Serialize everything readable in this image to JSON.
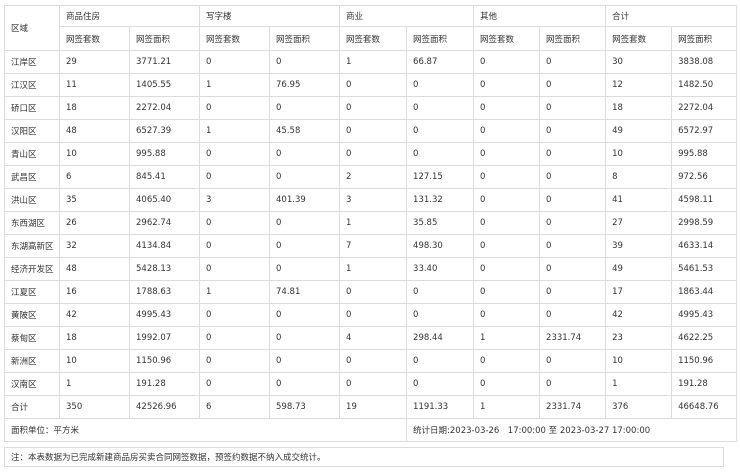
{
  "headers": {
    "district": "区域",
    "groups": [
      "商品住房",
      "写字楼",
      "商业",
      "其他",
      "合计"
    ],
    "sub_count": "网签套数",
    "sub_area": "网签面积"
  },
  "rows": [
    {
      "name": "江岸区",
      "v": [
        "29",
        "3771.21",
        "0",
        "0",
        "1",
        "66.87",
        "0",
        "0",
        "30",
        "3838.08"
      ]
    },
    {
      "name": "江汉区",
      "v": [
        "11",
        "1405.55",
        "1",
        "76.95",
        "0",
        "0",
        "0",
        "0",
        "12",
        "1482.50"
      ]
    },
    {
      "name": "硚口区",
      "v": [
        "18",
        "2272.04",
        "0",
        "0",
        "0",
        "0",
        "0",
        "0",
        "18",
        "2272.04"
      ]
    },
    {
      "name": "汉阳区",
      "v": [
        "48",
        "6527.39",
        "1",
        "45.58",
        "0",
        "0",
        "0",
        "0",
        "49",
        "6572.97"
      ]
    },
    {
      "name": "青山区",
      "v": [
        "10",
        "995.88",
        "0",
        "0",
        "0",
        "0",
        "0",
        "0",
        "10",
        "995.88"
      ]
    },
    {
      "name": "武昌区",
      "v": [
        "6",
        "845.41",
        "0",
        "0",
        "2",
        "127.15",
        "0",
        "0",
        "8",
        "972.56"
      ]
    },
    {
      "name": "洪山区",
      "v": [
        "35",
        "4065.40",
        "3",
        "401.39",
        "3",
        "131.32",
        "0",
        "0",
        "41",
        "4598.11"
      ]
    },
    {
      "name": "东西湖区",
      "v": [
        "26",
        "2962.74",
        "0",
        "0",
        "1",
        "35.85",
        "0",
        "0",
        "27",
        "2998.59"
      ]
    },
    {
      "name": "东湖高新区",
      "v": [
        "32",
        "4134.84",
        "0",
        "0",
        "7",
        "498.30",
        "0",
        "0",
        "39",
        "4633.14"
      ]
    },
    {
      "name": "经济开发区",
      "v": [
        "48",
        "5428.13",
        "0",
        "0",
        "1",
        "33.40",
        "0",
        "0",
        "49",
        "5461.53"
      ]
    },
    {
      "name": "江夏区",
      "v": [
        "16",
        "1788.63",
        "1",
        "74.81",
        "0",
        "0",
        "0",
        "0",
        "17",
        "1863.44"
      ]
    },
    {
      "name": "黄陂区",
      "v": [
        "42",
        "4995.43",
        "0",
        "0",
        "0",
        "0",
        "0",
        "0",
        "42",
        "4995.43"
      ]
    },
    {
      "name": "蔡甸区",
      "v": [
        "18",
        "1992.07",
        "0",
        "0",
        "4",
        "298.44",
        "1",
        "2331.74",
        "23",
        "4622.25"
      ]
    },
    {
      "name": "新洲区",
      "v": [
        "10",
        "1150.96",
        "0",
        "0",
        "0",
        "0",
        "0",
        "0",
        "10",
        "1150.96"
      ]
    },
    {
      "name": "汉南区",
      "v": [
        "1",
        "191.28",
        "0",
        "0",
        "0",
        "0",
        "0",
        "0",
        "1",
        "191.28"
      ]
    },
    {
      "name": "合计",
      "v": [
        "350",
        "42526.96",
        "6",
        "598.73",
        "19",
        "1191.33",
        "1",
        "2331.74",
        "376",
        "46648.76"
      ]
    }
  ],
  "footer": {
    "unit": "面积单位：平方米",
    "stat_time": "统计日期:2023-03-26　17:00:00 至 2023-03-27 17:00:00",
    "note": "注：本表数据为已完成新建商品房买卖合同网签数据，预签约数据不纳入成交统计。"
  }
}
